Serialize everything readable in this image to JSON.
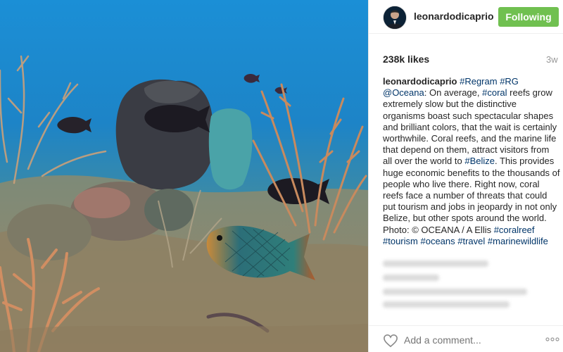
{
  "post": {
    "username": "leonardodicaprio",
    "follow_label": "Following",
    "likes": "238k likes",
    "time_ago": "3w",
    "caption_parts": [
      {
        "text": "leonardodicaprio",
        "kind": "user"
      },
      {
        "text": " ",
        "kind": "text"
      },
      {
        "text": "#Regram",
        "kind": "link"
      },
      {
        "text": " ",
        "kind": "text"
      },
      {
        "text": "#RG",
        "kind": "link"
      },
      {
        "text": " ",
        "kind": "text"
      },
      {
        "text": "@Oceana",
        "kind": "link"
      },
      {
        "text": ": On average, ",
        "kind": "text"
      },
      {
        "text": "#coral",
        "kind": "link"
      },
      {
        "text": " reefs grow extremely slow but the distinctive organisms boast such spectacular shapes and brilliant colors, that the wait is certainly worthwhile. Coral reefs, and the marine life that depend on them, attract visitors from all over the world to ",
        "kind": "text"
      },
      {
        "text": "#Belize",
        "kind": "link"
      },
      {
        "text": ". This provides huge economic benefits to the thousands of people who live there. Right now, coral reefs face a number of threats that could put tourism and jobs in jeopardy in not only Belize, but other spots around the world. Photo: © OCEANA / A Ellis ",
        "kind": "text"
      },
      {
        "text": "#coralreef",
        "kind": "link"
      },
      {
        "text": " ",
        "kind": "text"
      },
      {
        "text": "#tourism",
        "kind": "link"
      },
      {
        "text": " ",
        "kind": "text"
      },
      {
        "text": "#oceans",
        "kind": "link"
      },
      {
        "text": " ",
        "kind": "text"
      },
      {
        "text": "#travel",
        "kind": "link"
      },
      {
        "text": " ",
        "kind": "text"
      },
      {
        "text": "#marinewildlife",
        "kind": "link"
      }
    ],
    "comment_placeholder": "Add a comment...",
    "icons": {
      "like": "heart-icon",
      "more": "more-options-icon",
      "avatar": "profile-avatar"
    }
  },
  "colors": {
    "follow_button": "#70c050",
    "link": "#003569",
    "muted": "#999999",
    "text": "#262626"
  }
}
